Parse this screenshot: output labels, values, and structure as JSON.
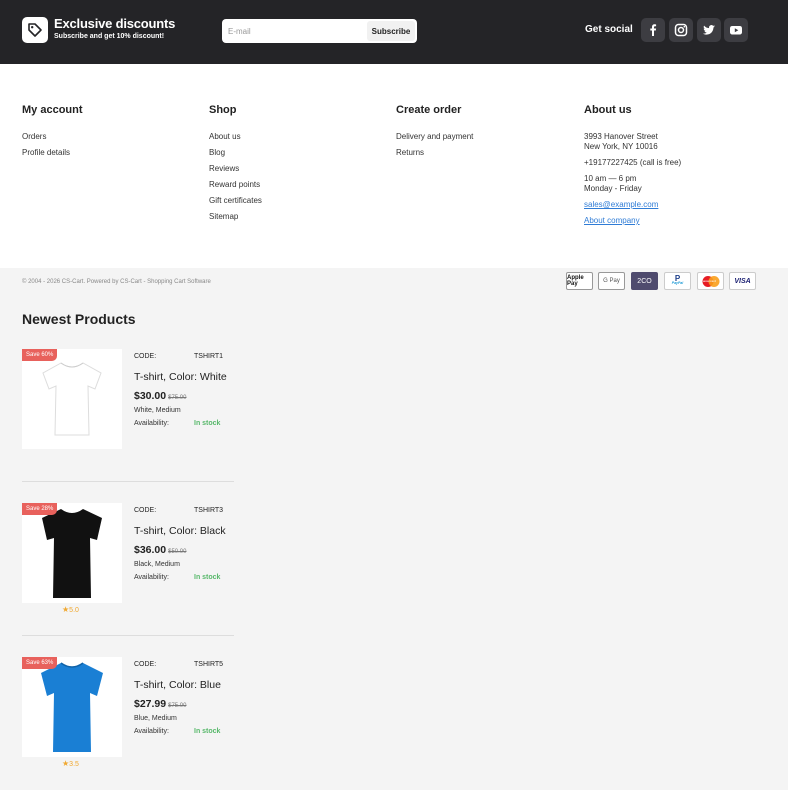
{
  "header": {
    "promo_title": "Exclusive discounts",
    "promo_subtitle": "Subscribe and get 10% discount!",
    "email_placeholder": "E-mail",
    "subscribe_label": "Subscribe",
    "social_label": "Get social",
    "social_icons": [
      "facebook-icon",
      "instagram-icon",
      "twitter-icon",
      "youtube-icon"
    ]
  },
  "footer": {
    "my_account": {
      "title": "My account",
      "items": [
        "Orders",
        "Profile details"
      ]
    },
    "shop": {
      "title": "Shop",
      "items": [
        "About us",
        "Blog",
        "Reviews",
        "Reward points",
        "Gift certificates",
        "Sitemap"
      ]
    },
    "create_order": {
      "title": "Create order",
      "items": [
        "Delivery and payment",
        "Returns"
      ]
    },
    "about_us": {
      "title": "About us",
      "address_line1": "3993 Hanover Street",
      "address_line2": "New York, NY 10016",
      "phone": "+19177227425 (call is free)",
      "hours": "10 am — 6 pm",
      "days": "Monday - Friday",
      "email": "sales@example.com",
      "about_link": "About company"
    },
    "copyright": "© 2004 - 2026 CS-Cart. Powered by CS-Cart - Shopping Cart Software",
    "payments": [
      "Apple Pay",
      "G Pay",
      "2CO",
      "PayPal",
      "mastercard",
      "VISA"
    ]
  },
  "newest": {
    "title": "Newest Products",
    "code_label": "CODE:",
    "availability_label": "Availability:",
    "products": [
      {
        "badge": "Save 60%",
        "code": "TSHIRT1",
        "name": "T-shirt, Color: White",
        "price": "$30.00",
        "old_price": "$75.00",
        "options": "White, Medium",
        "availability": "In stock",
        "rating": "",
        "color": "#ffffff"
      },
      {
        "badge": "Save 28%",
        "code": "TSHIRT3",
        "name": "T-shirt, Color: Black",
        "price": "$36.00",
        "old_price": "$50.00",
        "options": "Black, Medium",
        "availability": "In stock",
        "rating": "5.0",
        "color": "#111111"
      },
      {
        "badge": "Save 63%",
        "code": "TSHIRT5",
        "name": "T-shirt, Color: Blue",
        "price": "$27.99",
        "old_price": "$75.00",
        "options": "Blue, Medium",
        "availability": "In stock",
        "rating": "3.5",
        "color": "#1a7fd4"
      }
    ]
  },
  "colors": {
    "topbar": "#242427",
    "badge": "#e8615c",
    "in_stock": "#58b86b",
    "rating": "#f0a830",
    "link": "#2f7cd6"
  }
}
